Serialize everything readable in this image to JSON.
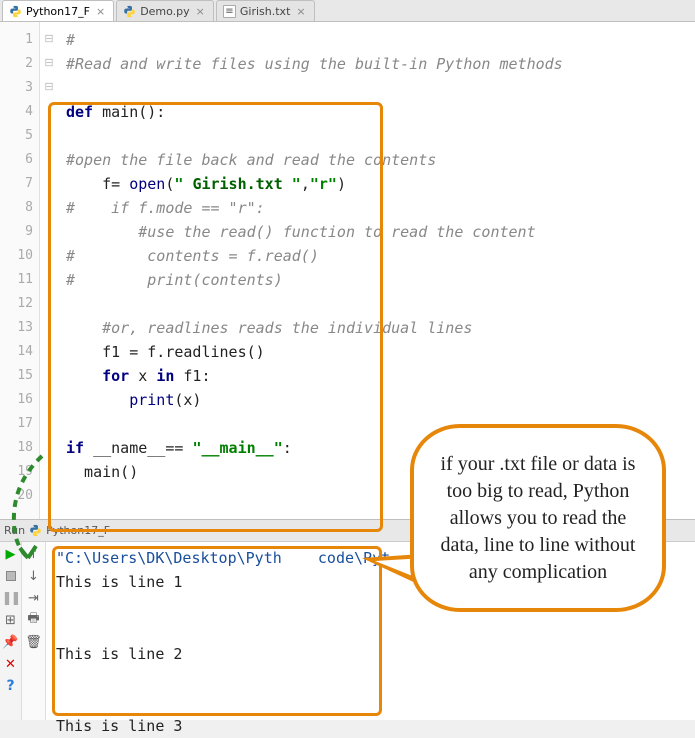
{
  "tabs": [
    {
      "label": "Python17_F",
      "type": "py",
      "active": true
    },
    {
      "label": "Demo.py",
      "type": "py",
      "active": false
    },
    {
      "label": "Girish.txt",
      "type": "txt",
      "active": false
    }
  ],
  "gutter": [
    "1",
    "2",
    "3",
    "4",
    "5",
    "6",
    "7",
    "8",
    "9",
    "10",
    "11",
    "12",
    "13",
    "14",
    "15",
    "16",
    "17",
    "18",
    "19",
    "20"
  ],
  "fold": [
    "",
    "",
    "",
    "⊟",
    "",
    "",
    "",
    "",
    "",
    "",
    "",
    "",
    "",
    "",
    "",
    "⊟",
    "",
    "",
    "",
    "⊟"
  ],
  "code": {
    "l1": "#",
    "l2": "#Read and write files using the built-in Python methods",
    "l3": "",
    "l4_kw": "def",
    "l4_fn": " main():",
    "l5": "",
    "l6": "#open the file back and read the contents",
    "l7_a": "    f= ",
    "l7_open": "open",
    "l7_p1": "(",
    "l7_s1": "\" ",
    "l7_name": "Girish.txt ",
    "l7_s2": "\"",
    "l7_c": ",",
    "l7_s3": "\"r\"",
    "l7_p2": ")",
    "l8": "#    if f.mode == \"r\":",
    "l9": "        #use the read() function to read the content",
    "l10": "#        contents = f.read()",
    "l11": "#        print(contents)",
    "l12": "",
    "l13": "    #or, readlines reads the individual lines",
    "l14": "    f1 = f.readlines()",
    "l15_a": "    ",
    "l15_for": "for",
    "l15_b": " x ",
    "l15_in": "in",
    "l15_c": " f1:",
    "l16_a": "       ",
    "l16_print": "print",
    "l16_b": "(x)",
    "l17": "",
    "l18_a": "",
    "l18_if": "if",
    "l18_b": " __name__== ",
    "l18_s": "\"__main__\"",
    "l18_c": ":",
    "l19": "  main()"
  },
  "run": {
    "header_prefix": "Run",
    "header_conf": "Python17_F",
    "cmdline": "\"C:\\Users\\DK\\Desktop\\Pyth    code\\Pyt",
    "out1": "This is line 1",
    "out2": "This is line 2",
    "out3": "This is line 3"
  },
  "bubble": "if your .txt file or data is too big to read, Python allows you to read the data, line to line without any complication"
}
